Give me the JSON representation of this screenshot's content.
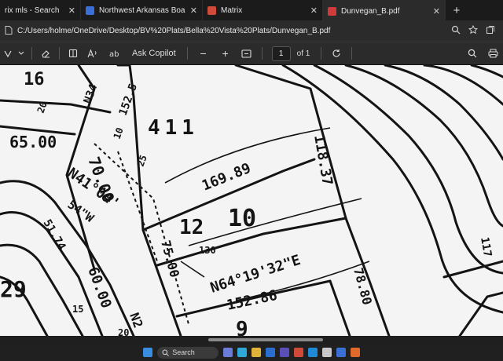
{
  "tabs": [
    {
      "label": "rix mls - Search",
      "close": "✕",
      "icon_color": "#c8c8c8",
      "active": false
    },
    {
      "label": "Northwest Arkansas Board of",
      "close": "✕",
      "icon_color": "#3b6fd8",
      "active": false
    },
    {
      "label": "Matrix",
      "close": "✕",
      "icon_color": "#d04a3a",
      "active": false
    },
    {
      "label": "Dunvegan_B.pdf",
      "close": "✕",
      "icon_color": "#d23b3b",
      "active": true
    }
  ],
  "new_tab": "+",
  "address": {
    "info_icon": "document-icon",
    "url": "C:/Users/holme/OneDrive/Desktop/BV%20Plats/Bella%20Vista%20Plats/Dunvegan_B.pdf"
  },
  "toolbar": {
    "ask_copilot": "Ask Copilot",
    "zoom_out": "−",
    "zoom_in": "+",
    "page_current": "1",
    "page_total": "of 1"
  },
  "plat": {
    "labels": {
      "lot16": "16",
      "n34": "N34",
      "d20": "20",
      "d1525": "152.5",
      "d6500": "65.00",
      "lot411": "411",
      "d10": "10",
      "d25": "25",
      "d7000": "70.00",
      "d16989": "169.89",
      "d11837": "118.37",
      "n4104": "N41°04'",
      "d54w": "54\"W",
      "d5174": "51.74",
      "lot12": "12",
      "d130": "130",
      "lot10": "10",
      "n6419": "N64°19'32\"E",
      "d7500": "75.00",
      "d15286": "152.86",
      "d7880": "78.80",
      "lot29": "29",
      "d6000": "60.00",
      "d15": "15",
      "d117": "117",
      "lot9": "9",
      "n2": "N2",
      "d20b": "20"
    }
  },
  "taskbar": {
    "search_label": "Search"
  },
  "colors": {
    "browser_bg": "#1f1f1f",
    "tab_active": "#2b2b2b",
    "ink": "#141414",
    "paper": "#f4f4f4"
  }
}
